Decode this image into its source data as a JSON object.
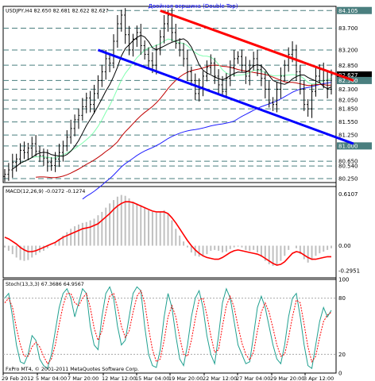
{
  "main": {
    "symbol_header": "USDJPY,H4  82.650 82.681 82.622 82.627",
    "annotation": "Двойная вершина (Double Top)",
    "price_labels": [
      "84.105",
      "83.700",
      "83.200",
      "82.850",
      "82.627",
      "82.500",
      "82.300",
      "82.050",
      "81.850",
      "81.550",
      "81.250",
      "81.000",
      "80.650",
      "80.540",
      "80.250"
    ],
    "highlighted_labels": [
      "84.105",
      "82.627",
      "82.500",
      "81.000"
    ]
  },
  "macd": {
    "header": "MACD(12,26,9) -0.0272 -0.1274",
    "labels": [
      "0.6107",
      "0.00",
      "-0.2951"
    ]
  },
  "stoch": {
    "header": "Stoch(13,3,3) 67.3686 64.9567",
    "labels": [
      "100",
      "80",
      "20",
      "0"
    ]
  },
  "footer": {
    "copyright": "FxPro MT4, © 2001-2011 MetaQuotes Software Corp."
  },
  "x_labels": [
    "29 Feb 2012",
    "5 Mar 04:00",
    "7 Mar 20:00",
    "12 Mar 12:00",
    "15 Mar 04:00",
    "19 Mar 20:00",
    "22 Mar 12:00",
    "27 Mar 04:00",
    "29 Mar 20:00",
    "3 Apr 12:00"
  ],
  "chart_data": [
    {
      "type": "candlestick",
      "title": "USDJPY,H4",
      "ylim": [
        80.16,
        84.2
      ],
      "close": [
        80.35,
        80.45,
        80.62,
        80.7,
        80.9,
        80.85,
        80.95,
        81.05,
        80.88,
        80.78,
        80.72,
        80.62,
        80.55,
        80.7,
        80.85,
        81.0,
        81.2,
        81.4,
        81.6,
        81.7,
        81.9,
        82.1,
        81.95,
        82.2,
        82.5,
        82.7,
        83.0,
        82.9,
        83.4,
        83.8,
        84.0,
        83.55,
        83.2,
        83.45,
        83.6,
        83.3,
        83.1,
        82.95,
        82.85,
        83.2,
        83.5,
        83.8,
        84.0,
        83.6,
        83.35,
        83.2,
        83.0,
        82.7,
        82.5,
        82.2,
        82.35,
        82.6,
        82.8,
        82.9,
        82.6,
        82.4,
        82.25,
        82.55,
        82.8,
        83.0,
        83.05,
        82.85,
        82.6,
        82.85,
        83.0,
        82.75,
        82.55,
        82.3,
        82.0,
        81.95,
        82.3,
        82.6,
        82.85,
        83.1,
        83.2,
        82.7,
        82.3,
        81.95,
        81.85,
        82.25,
        82.6,
        82.75,
        82.5,
        82.3,
        82.63
      ]
    },
    {
      "type": "line",
      "title": "MACD(12,26,9)",
      "ylim": [
        -0.38,
        0.7
      ],
      "histogram": [
        -0.02,
        -0.06,
        -0.1,
        -0.14,
        -0.17,
        -0.18,
        -0.17,
        -0.14,
        -0.11,
        -0.08,
        -0.06,
        -0.03,
        0.0,
        0.04,
        0.08,
        0.12,
        0.16,
        0.2,
        0.23,
        0.25,
        0.27,
        0.28,
        0.3,
        0.32,
        0.36,
        0.4,
        0.45,
        0.5,
        0.54,
        0.58,
        0.6,
        0.59,
        0.56,
        0.52,
        0.5,
        0.48,
        0.45,
        0.42,
        0.4,
        0.39,
        0.4,
        0.42,
        0.38,
        0.3,
        0.2,
        0.12,
        0.05,
        -0.02,
        -0.08,
        -0.12,
        -0.13,
        -0.12,
        -0.1,
        -0.06,
        -0.05,
        -0.06,
        -0.08,
        -0.07,
        -0.04,
        -0.02,
        -0.01,
        -0.02,
        -0.05,
        -0.06,
        -0.05,
        -0.08,
        -0.13,
        -0.18,
        -0.22,
        -0.24,
        -0.22,
        -0.18,
        -0.12,
        -0.05,
        0.0,
        -0.03,
        -0.1,
        -0.16,
        -0.2,
        -0.17,
        -0.12,
        -0.09,
        -0.07,
        -0.05,
        -0.03
      ],
      "signal": [
        0.1,
        0.08,
        0.05,
        0.02,
        -0.02,
        -0.05,
        -0.07,
        -0.07,
        -0.06,
        -0.04,
        -0.02,
        0.0,
        0.02,
        0.04,
        0.07,
        0.1,
        0.12,
        0.14,
        0.16,
        0.18,
        0.2,
        0.21,
        0.22,
        0.24,
        0.26,
        0.3,
        0.34,
        0.38,
        0.43,
        0.47,
        0.5,
        0.52,
        0.52,
        0.51,
        0.49,
        0.47,
        0.45,
        0.43,
        0.41,
        0.4,
        0.4,
        0.4,
        0.38,
        0.33,
        0.27,
        0.2,
        0.13,
        0.06,
        0.0,
        -0.05,
        -0.09,
        -0.12,
        -0.14,
        -0.15,
        -0.16,
        -0.16,
        -0.14,
        -0.11,
        -0.08,
        -0.06,
        -0.05,
        -0.06,
        -0.07,
        -0.08,
        -0.09,
        -0.1,
        -0.12,
        -0.15,
        -0.18,
        -0.21,
        -0.23,
        -0.22,
        -0.19,
        -0.14,
        -0.09,
        -0.07,
        -0.08,
        -0.11,
        -0.14,
        -0.16,
        -0.16,
        -0.15,
        -0.14,
        -0.13,
        -0.13
      ]
    },
    {
      "type": "line",
      "title": "Stoch(13,3,3)",
      "ylim": [
        0,
        100
      ],
      "main": [
        80,
        85,
        60,
        30,
        12,
        10,
        20,
        40,
        35,
        15,
        8,
        5,
        20,
        45,
        70,
        85,
        90,
        80,
        60,
        75,
        90,
        85,
        50,
        30,
        25,
        60,
        85,
        92,
        80,
        50,
        30,
        35,
        60,
        85,
        92,
        88,
        50,
        20,
        8,
        6,
        25,
        60,
        85,
        70,
        40,
        15,
        8,
        30,
        60,
        80,
        88,
        70,
        40,
        20,
        10,
        40,
        75,
        90,
        80,
        55,
        30,
        20,
        10,
        12,
        40,
        70,
        82,
        70,
        50,
        30,
        15,
        10,
        30,
        60,
        80,
        85,
        60,
        30,
        8,
        5,
        30,
        55,
        70,
        60,
        67
      ],
      "signal": [
        75,
        80,
        70,
        48,
        30,
        18,
        18,
        28,
        33,
        28,
        18,
        10,
        15,
        30,
        52,
        72,
        85,
        85,
        75,
        72,
        80,
        85,
        70,
        48,
        35,
        45,
        65,
        82,
        85,
        70,
        50,
        38,
        45,
        65,
        82,
        88,
        75,
        48,
        25,
        12,
        15,
        35,
        60,
        72,
        60,
        38,
        20,
        18,
        35,
        58,
        78,
        80,
        62,
        40,
        22,
        25,
        50,
        72,
        82,
        70,
        50,
        32,
        20,
        14,
        22,
        45,
        65,
        75,
        65,
        48,
        30,
        18,
        20,
        38,
        60,
        78,
        75,
        52,
        28,
        12,
        18,
        38,
        55,
        62,
        65
      ]
    }
  ],
  "colors": {
    "grid": "#4a7f7f",
    "bear_line": "#ff0000",
    "bull_line": "#0000ff",
    "annotation": "#0000ff",
    "ma_black": "#000000",
    "ma_green": "#80ffb0",
    "ma_red": "#c00000",
    "ma_blue": "#2020ff",
    "macd_hist": "#c0c0c0",
    "macd_signal": "#ff0000",
    "stoch_main": "#20a090",
    "stoch_signal": "#ff0000"
  }
}
